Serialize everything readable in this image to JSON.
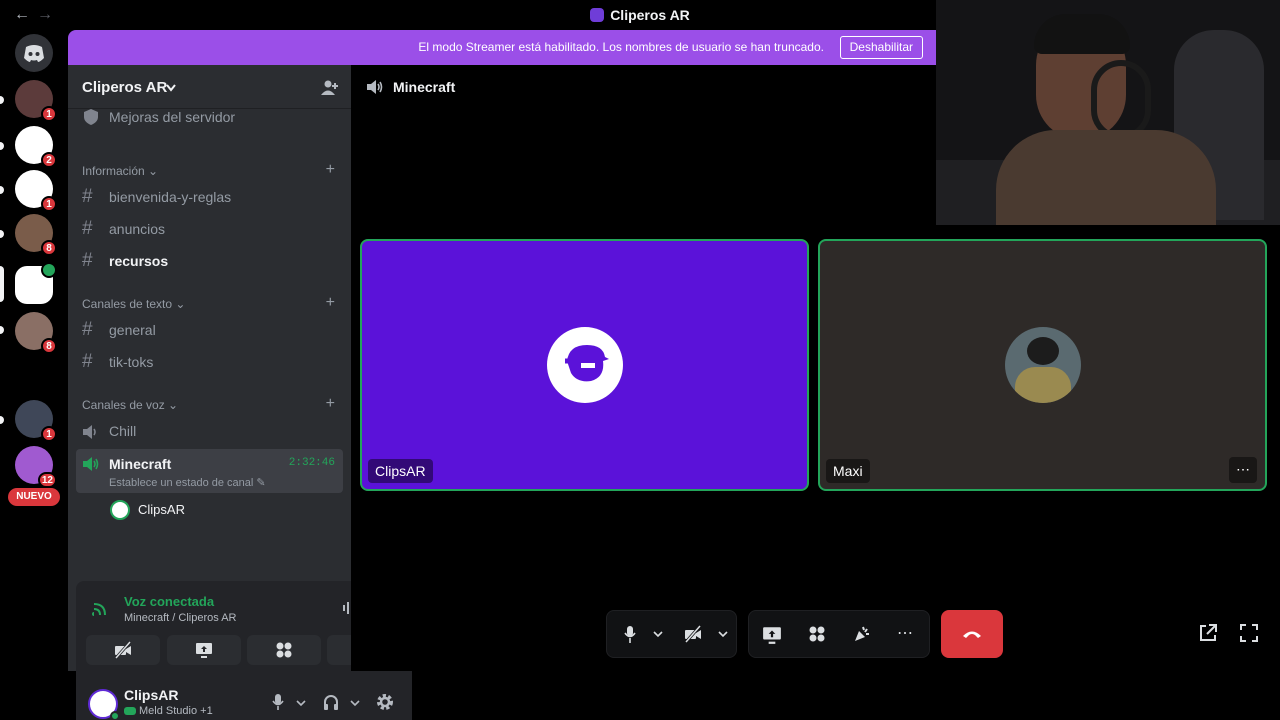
{
  "window": {
    "title": "Cliperos AR"
  },
  "banner": {
    "text": "El modo Streamer está habilitado. Los nombres de usuario se han truncado.",
    "button": "Deshabilitar"
  },
  "guilds": [
    {
      "badge": "1",
      "color": "#5c3b3b"
    },
    {
      "badge": "2",
      "color": "#ffffff"
    },
    {
      "badge": "1",
      "color": "#ffffff"
    },
    {
      "badge": "8",
      "color": "#7a5c4a"
    },
    {
      "badge": "",
      "color": "#ffffff"
    },
    {
      "badge": "8",
      "color": "#8a6f65"
    },
    {
      "badge": "",
      "color": "#000000"
    },
    {
      "badge": "1",
      "color": "#3f4758"
    },
    {
      "badge": "12",
      "color": "#a05ad0"
    }
  ],
  "guild_new_label": "NUEVO",
  "server": {
    "name": "Cliperos AR"
  },
  "channels": {
    "boost": "Mejoras del servidor",
    "cat_info": "Información",
    "info_items": [
      "bienvenida-y-reglas",
      "anuncios",
      "recursos"
    ],
    "cat_text": "Canales de texto",
    "text_items": [
      "general",
      "tik-toks"
    ],
    "cat_voice": "Canales de voz",
    "voice_chill": "Chill",
    "voice_active": {
      "name": "Minecraft",
      "time": "2:32:46",
      "status": "Establece un estado de canal"
    },
    "member": "ClipsAR"
  },
  "voice_panel": {
    "status": "Voz conectada",
    "location": "Minecraft / Cliperos AR"
  },
  "user": {
    "name": "ClipsAR",
    "activity": "Meld Studio +1"
  },
  "stage": {
    "channel": "Minecraft",
    "tiles": [
      {
        "name": "ClipsAR",
        "bg": "#5b12d9"
      },
      {
        "name": "Maxi",
        "bg": "#2e2a28"
      }
    ]
  },
  "colors": {
    "accent": "#5865f2",
    "online": "#23a55a",
    "danger": "#da373c",
    "banner": "#9b4fe8"
  }
}
